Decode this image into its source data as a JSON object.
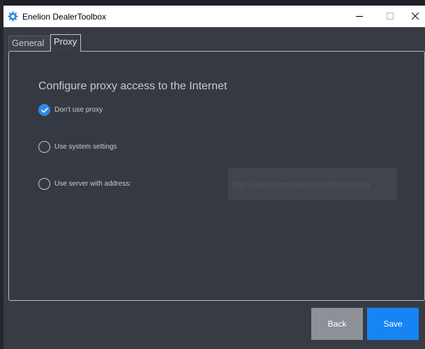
{
  "window": {
    "title": "Enelion DealerToolbox",
    "icon": "gear-icon",
    "controls": [
      "minimize-icon",
      "maximize-icon",
      "close-icon"
    ]
  },
  "tabs": [
    {
      "label": "General",
      "active": false
    },
    {
      "label": "Proxy",
      "active": true
    }
  ],
  "proxy": {
    "heading": "Configure proxy access to the Internet",
    "options": [
      {
        "label": "Don't use proxy",
        "selected": true
      },
      {
        "label": "Use system settings",
        "selected": false
      },
      {
        "label": "Use server with address:",
        "selected": false
      }
    ],
    "address_placeholder": "http://username:password@host:port"
  },
  "buttons": {
    "back_label": "Back",
    "save_label": "Save"
  },
  "colors": {
    "accent": "#1684f5",
    "background": "#373c44",
    "back_button": "#8c9097"
  }
}
